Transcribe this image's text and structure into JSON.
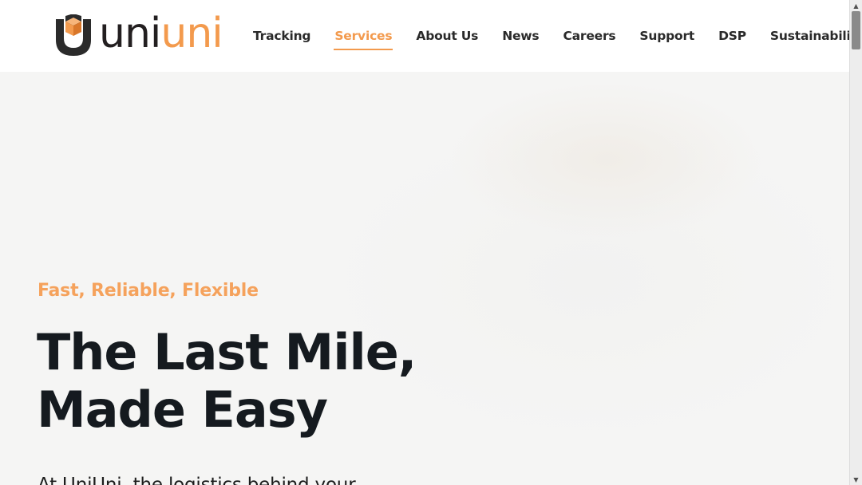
{
  "brand": {
    "logo_part1": "uni",
    "logo_part2": "uni",
    "colors": {
      "orange": "#f39a4d",
      "dark": "#231f20"
    }
  },
  "nav": {
    "items": [
      {
        "label": "Tracking",
        "active": false
      },
      {
        "label": "Services",
        "active": true
      },
      {
        "label": "About Us",
        "active": false
      },
      {
        "label": "News",
        "active": false
      },
      {
        "label": "Careers",
        "active": false
      },
      {
        "label": "Support",
        "active": false
      },
      {
        "label": "DSP",
        "active": false
      },
      {
        "label": "Sustainability",
        "active": false
      }
    ]
  },
  "hero": {
    "tagline": "Fast, Reliable, Flexible",
    "headline_line1": "The Last Mile,",
    "headline_line2": "Made Easy",
    "intro": "At UniUni, the logistics behind your"
  },
  "scrollbar": {
    "up_icon": "triangle-up-icon",
    "down_icon": "triangle-down-icon"
  }
}
